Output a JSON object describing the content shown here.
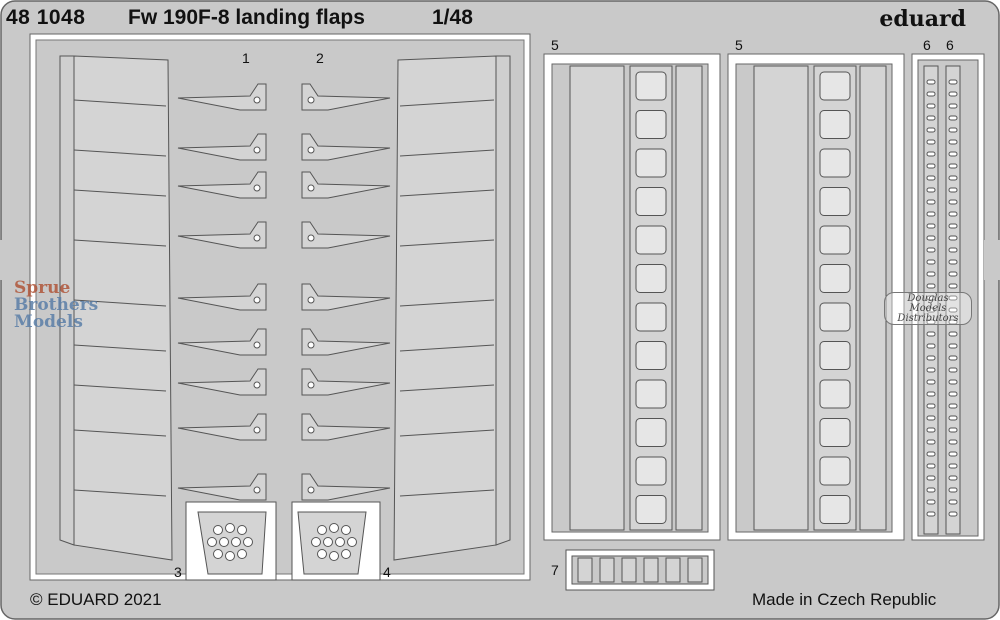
{
  "header": {
    "code": "48 1048",
    "name": "Fw 190F-8 landing flaps",
    "scale": "1/48",
    "brand": "eduard"
  },
  "footer": {
    "copyright": "© EDUARD 2021",
    "origin": "Made in Czech Republic"
  },
  "part_numbers": {
    "p1": "1",
    "p2": "2",
    "p3": "3",
    "p4": "4",
    "p5a": "5",
    "p5b": "5",
    "p6a": "6",
    "p6b": "6",
    "p7": "7"
  },
  "watermarks": {
    "sprue_line1": "Sprue",
    "sprue_line2": "Brothers",
    "sprue_line3": "Models",
    "dmd_line1": "Douglas",
    "dmd_line2": "Models",
    "dmd_line3": "Distributors"
  },
  "colors": {
    "fret": "#c9c9c9",
    "part": "#d4d4d4",
    "outline": "#555555",
    "background": "#ffffff"
  }
}
